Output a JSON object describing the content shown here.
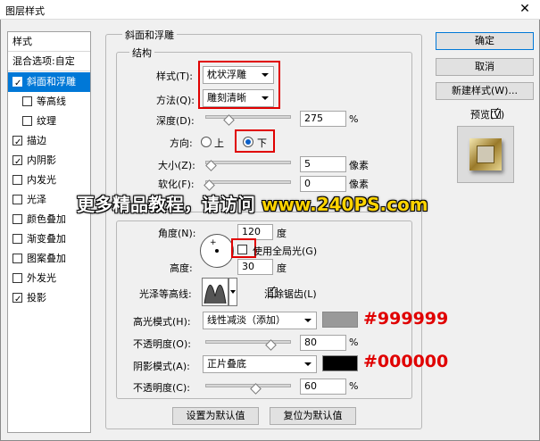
{
  "window": {
    "title": "图层样式",
    "close": "✕"
  },
  "sidebar": {
    "items": [
      {
        "label": "样式",
        "type": "header"
      },
      {
        "label": "混合选项:自定",
        "type": "header"
      },
      {
        "label": "斜面和浮雕",
        "checked": true,
        "selected": true
      },
      {
        "label": "等高线",
        "checked": false,
        "sub": true
      },
      {
        "label": "纹理",
        "checked": false,
        "sub": true
      },
      {
        "label": "描边",
        "checked": true
      },
      {
        "label": "内阴影",
        "checked": true
      },
      {
        "label": "内发光",
        "checked": false
      },
      {
        "label": "光泽",
        "checked": false
      },
      {
        "label": "颜色叠加",
        "checked": false
      },
      {
        "label": "渐变叠加",
        "checked": false
      },
      {
        "label": "图案叠加",
        "checked": false
      },
      {
        "label": "外发光",
        "checked": false
      },
      {
        "label": "投影",
        "checked": true
      }
    ]
  },
  "panel": {
    "group_title": "斜面和浮雕",
    "structure": {
      "title": "结构",
      "style_label": "样式(T):",
      "style_value": "枕状浮雕",
      "technique_label": "方法(Q):",
      "technique_value": "雕刻清晰",
      "depth_label": "深度(D):",
      "depth_value": "275",
      "depth_unit": "%",
      "depth_fraction": 0.25,
      "direction_label": "方向:",
      "direction_up": "上",
      "direction_down": "下",
      "direction_selected": "下",
      "size_label": "大小(Z):",
      "size_value": "5",
      "size_unit": "像素",
      "size_fraction": 0.02,
      "soften_label": "软化(F):",
      "soften_value": "0",
      "soften_unit": "像素",
      "soften_fraction": 0.0
    },
    "shading": {
      "angle_label": "角度(N):",
      "angle_value": "120",
      "angle_unit": "度",
      "global_light_label": "使用全局光(G)",
      "global_light_checked": false,
      "altitude_label": "高度:",
      "altitude_value": "30",
      "altitude_unit": "度",
      "gloss_contour_label": "光泽等高线:",
      "antialias_label": "消除锯齿(L)",
      "antialias_checked": true,
      "highlight_mode_label": "高光模式(H):",
      "highlight_mode_value": "线性减淡（添加）",
      "highlight_color": "#999999",
      "highlight_opacity_label": "不透明度(O):",
      "highlight_opacity_value": "80",
      "highlight_opacity_unit": "%",
      "highlight_opacity_fraction": 0.8,
      "shadow_mode_label": "阴影模式(A):",
      "shadow_mode_value": "正片叠底",
      "shadow_color": "#000000",
      "shadow_opacity_label": "不透明度(C):",
      "shadow_opacity_value": "60",
      "shadow_opacity_unit": "%",
      "shadow_opacity_fraction": 0.6
    },
    "make_default": "设置为默认值",
    "reset_default": "复位为默认值"
  },
  "buttons": {
    "ok": "确定",
    "cancel": "取消",
    "new_style": "新建样式(W)...",
    "preview_label": "预览(V)",
    "preview_checked": true
  },
  "annotations": {
    "highlight_color_text": "#999999",
    "shadow_color_text": "#000000"
  },
  "watermark": {
    "text": "更多精品教程，请访问",
    "url": "www.240PS.com"
  }
}
